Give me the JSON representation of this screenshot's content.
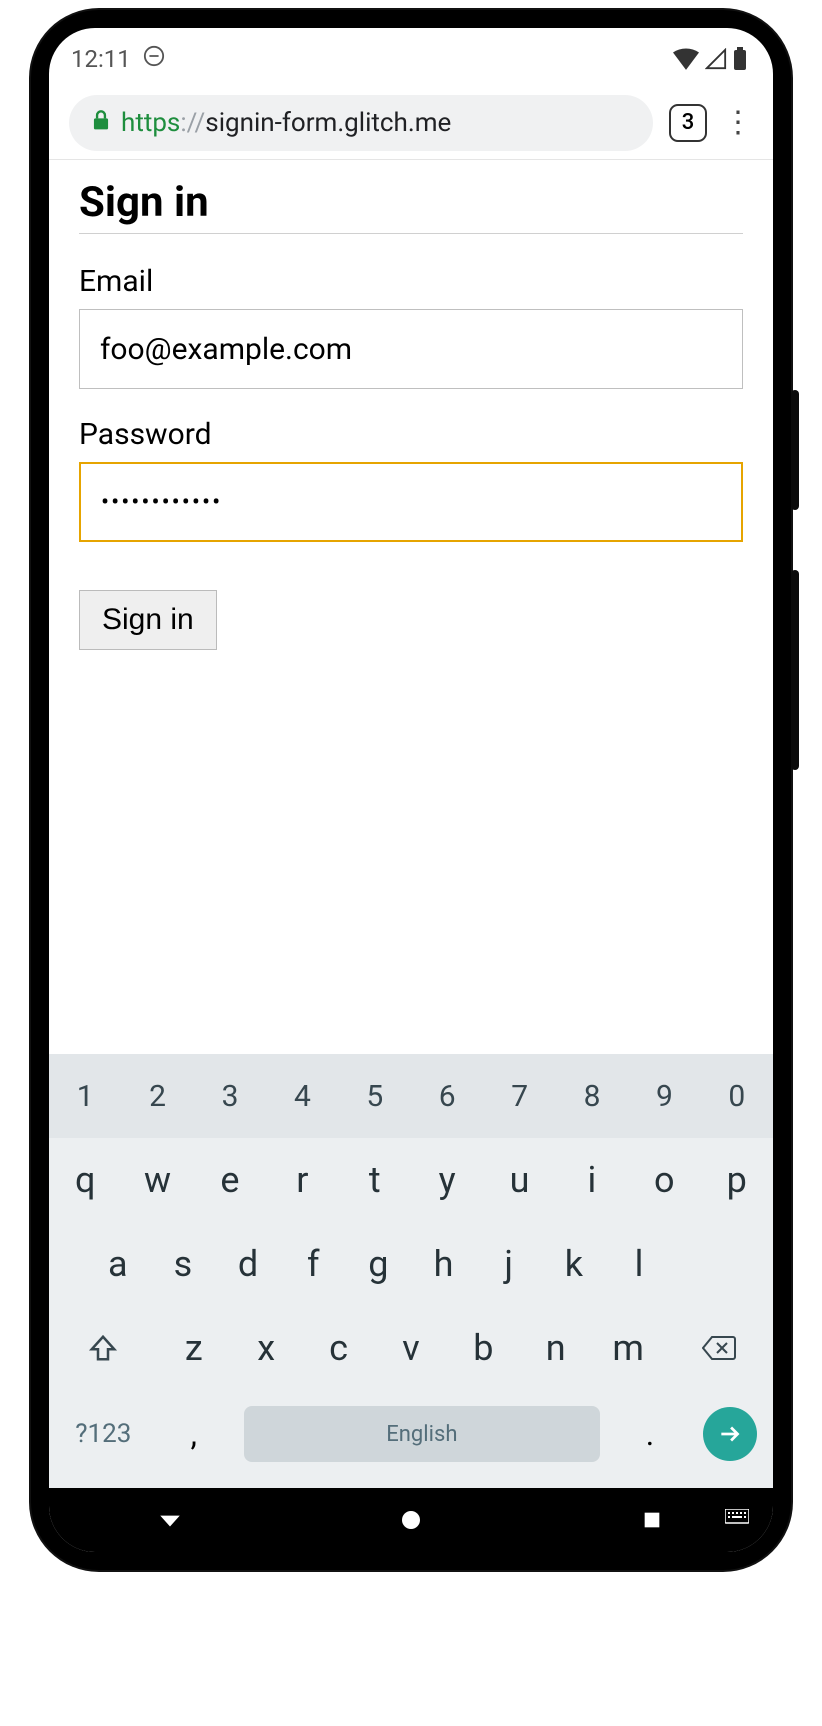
{
  "status": {
    "time": "12:11",
    "tab_count": "3"
  },
  "url": {
    "scheme": "https",
    "colon": "://",
    "host": "signin-form.glitch.me"
  },
  "page": {
    "heading": "Sign in",
    "email_label": "Email",
    "email_value": "foo@example.com",
    "password_label": "Password",
    "password_value": "••••••••••••",
    "submit_label": "Sign in"
  },
  "keyboard": {
    "numrow": [
      "1",
      "2",
      "3",
      "4",
      "5",
      "6",
      "7",
      "8",
      "9",
      "0"
    ],
    "row2": [
      "q",
      "w",
      "e",
      "r",
      "t",
      "y",
      "u",
      "i",
      "o",
      "p"
    ],
    "row3": [
      "a",
      "s",
      "d",
      "f",
      "g",
      "h",
      "j",
      "k",
      "l"
    ],
    "row4": [
      "z",
      "x",
      "c",
      "v",
      "b",
      "n",
      "m"
    ],
    "symbols_label": "?123",
    "comma": ",",
    "space_label": "English",
    "period": "."
  }
}
